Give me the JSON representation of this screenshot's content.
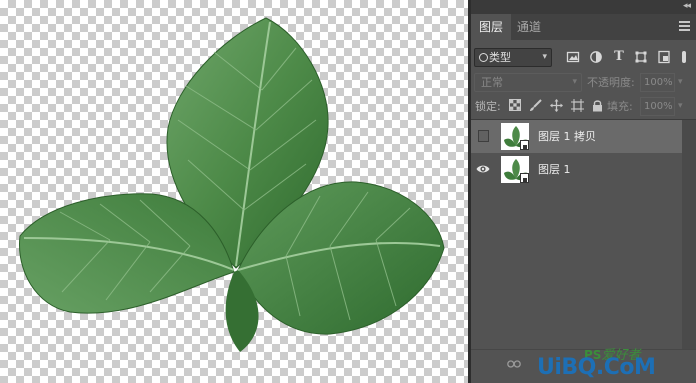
{
  "panel": {
    "tabs": [
      {
        "label": "图层",
        "active": true
      },
      {
        "label": "通道",
        "active": false
      }
    ],
    "collapse_glyph": "◂◂",
    "filter": {
      "label": "类型",
      "icons": [
        "image-filter-icon",
        "adjustment-filter-icon",
        "type-filter-icon",
        "shape-filter-icon",
        "smart-object-filter-icon"
      ]
    },
    "blend_mode": "正常",
    "opacity_label": "不透明度:",
    "opacity_value": "100%",
    "lock_label": "锁定:",
    "fill_label": "填充:",
    "fill_value": "100%"
  },
  "layers": [
    {
      "name": "图层 1 拷贝",
      "visible": false,
      "selected": true
    },
    {
      "name": "图层 1",
      "visible": true,
      "selected": false
    }
  ],
  "watermark": {
    "ps_text": "PS",
    "cn_text": "爱好者",
    "brand": "UiBQ.CoM"
  },
  "colors": {
    "panel_bg": "#535353",
    "selected_layer": "#6a6a6a",
    "leaf_green": "#3f7a3c"
  }
}
